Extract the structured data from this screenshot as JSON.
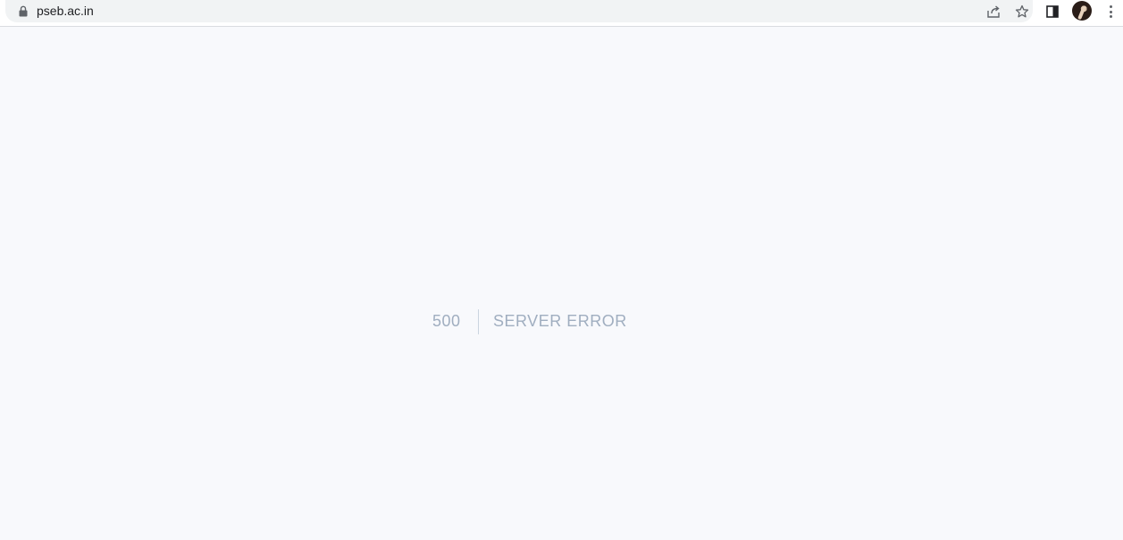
{
  "browser": {
    "url": "pseb.ac.in",
    "icons": {
      "lock": "lock-icon",
      "share": "share-icon",
      "bookmark": "star-icon",
      "side_panel": "side-panel-icon",
      "profile": "avatar",
      "menu": "kebab-menu-icon"
    }
  },
  "page": {
    "error_code": "500",
    "error_message": "SERVER ERROR"
  },
  "colors": {
    "page_background": "#f8f9fc",
    "error_text": "#a0aec0",
    "divider": "#cbd5e0"
  }
}
